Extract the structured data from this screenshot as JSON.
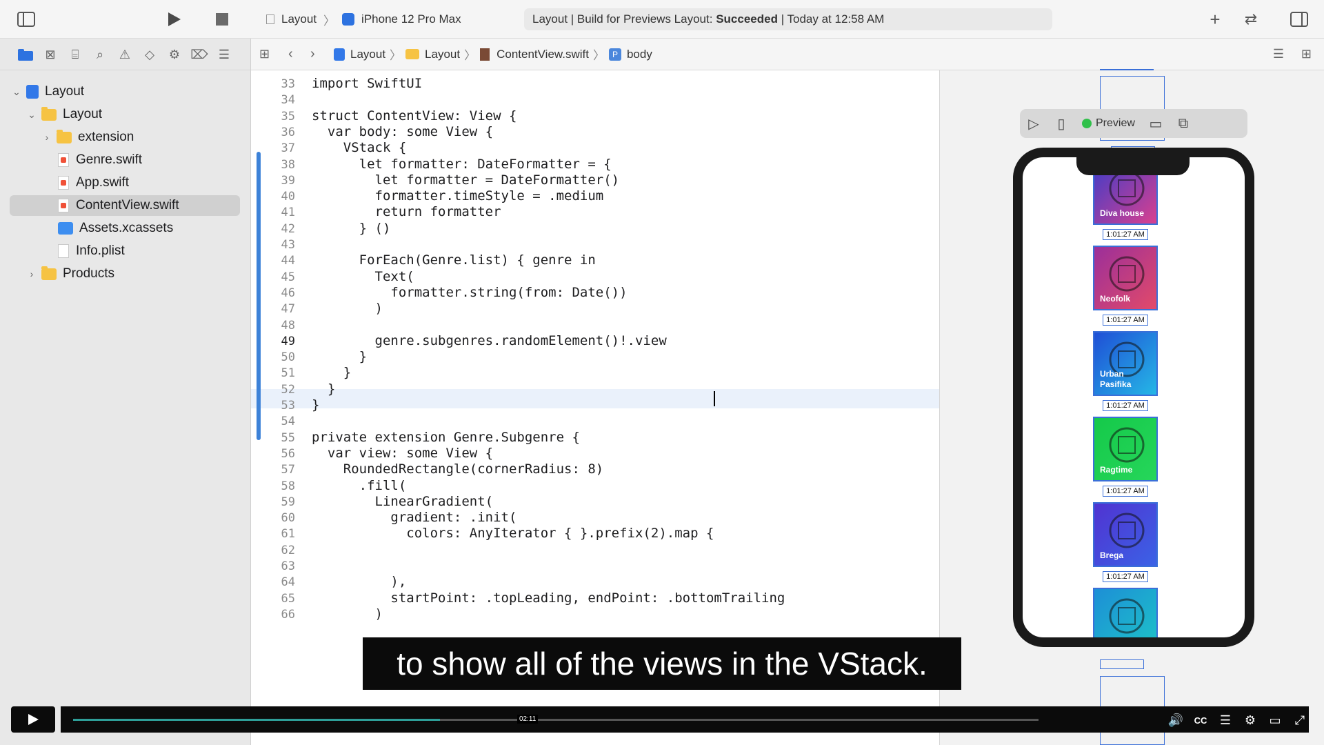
{
  "toolbar": {
    "scheme_target": "Layout",
    "device": "iPhone 12 Pro Max",
    "status_prefix": "Layout | Build for Previews Layout:",
    "status_result": "Succeeded",
    "status_time": "| Today at 12:58 AM"
  },
  "navigator": {
    "items": [
      {
        "label": "Layout",
        "kind": "project"
      },
      {
        "label": "Layout",
        "kind": "folder"
      },
      {
        "label": "extension",
        "kind": "folder"
      },
      {
        "label": "Genre.swift",
        "kind": "swift"
      },
      {
        "label": "App.swift",
        "kind": "swift"
      },
      {
        "label": "ContentView.swift",
        "kind": "swift",
        "selected": true
      },
      {
        "label": "Assets.xcassets",
        "kind": "assets"
      },
      {
        "label": "Info.plist",
        "kind": "plist"
      },
      {
        "label": "Products",
        "kind": "folder"
      }
    ]
  },
  "jumpbar": {
    "crumbs": [
      "Layout",
      "Layout",
      "ContentView.swift",
      "body"
    ]
  },
  "editor": {
    "current_line": "49",
    "lines": [
      {
        "n": "33",
        "text": "import SwiftUI"
      },
      {
        "n": "34",
        "text": ""
      },
      {
        "n": "35",
        "text": "struct ContentView: View {"
      },
      {
        "n": "36",
        "text": "  var body: some View {"
      },
      {
        "n": "37",
        "text": "    VStack {"
      },
      {
        "n": "38",
        "text": "      let formatter: DateFormatter = {"
      },
      {
        "n": "39",
        "text": "        let formatter = DateFormatter()"
      },
      {
        "n": "40",
        "text": "        formatter.timeStyle = .medium"
      },
      {
        "n": "41",
        "text": "        return formatter"
      },
      {
        "n": "42",
        "text": "      } ()"
      },
      {
        "n": "43",
        "text": ""
      },
      {
        "n": "44",
        "text": "      ForEach(Genre.list) { genre in"
      },
      {
        "n": "45",
        "text": "        Text("
      },
      {
        "n": "46",
        "text": "          formatter.string(from: Date())"
      },
      {
        "n": "47",
        "text": "        )"
      },
      {
        "n": "48",
        "text": ""
      },
      {
        "n": "49",
        "text": "        genre.subgenres.randomElement()!.view"
      },
      {
        "n": "50",
        "text": "      }"
      },
      {
        "n": "51",
        "text": "    }"
      },
      {
        "n": "52",
        "text": "  }"
      },
      {
        "n": "53",
        "text": "}"
      },
      {
        "n": "54",
        "text": ""
      },
      {
        "n": "55",
        "text": "private extension Genre.Subgenre {"
      },
      {
        "n": "56",
        "text": "  var view: some View {"
      },
      {
        "n": "57",
        "text": "    RoundedRectangle(cornerRadius: 8)"
      },
      {
        "n": "58",
        "text": "      .fill("
      },
      {
        "n": "59",
        "text": "        LinearGradient("
      },
      {
        "n": "60",
        "text": "          gradient: .init("
      },
      {
        "n": "61",
        "text": "            colors: AnyIterator { }.prefix(2).map {"
      },
      {
        "n": "62",
        "text": ""
      },
      {
        "n": "63",
        "text": ""
      },
      {
        "n": "64",
        "text": "          ),"
      },
      {
        "n": "65",
        "text": "          startPoint: .topLeading, endPoint: .bottomTrailing"
      },
      {
        "n": "66",
        "text": "        )"
      }
    ]
  },
  "preview": {
    "label": "Preview",
    "status_color": "#30c04a",
    "tiles": [
      {
        "label": "Diva house",
        "time": "1:01:27 AM",
        "from": "#3f3cc8",
        "to": "#d9408f"
      },
      {
        "label": "Neofolk",
        "time": "1:01:27 AM",
        "from": "#9b2f9a",
        "to": "#e24a6a"
      },
      {
        "label": "Urban\nPasifika",
        "time": "1:01:27 AM",
        "from": "#1f4fd6",
        "to": "#25b7e6"
      },
      {
        "label": "Ragtime",
        "time": "1:01:27 AM",
        "from": "#15c94a",
        "to": "#26d65a"
      },
      {
        "label": "Brega",
        "time": "1:01:27 AM",
        "from": "#5033d1",
        "to": "#3b62e6"
      },
      {
        "label": "",
        "time": "",
        "from": "#1d8fd6",
        "to": "#1dc3c8"
      }
    ]
  },
  "overlay": {
    "subtitle": "to show all of the views in the VStack.",
    "video_time": "02:11",
    "video_progress": 0.38
  }
}
